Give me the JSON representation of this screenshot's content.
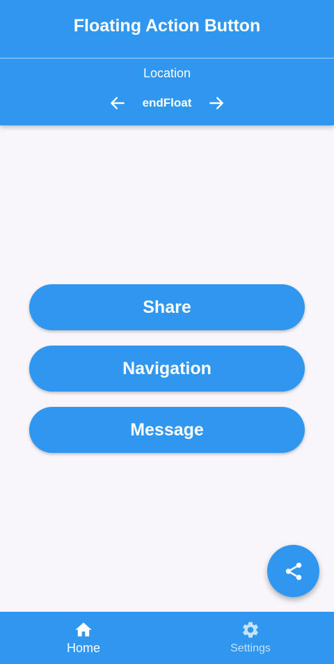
{
  "appbar": {
    "title": "Floating Action Button",
    "location_label": "Location",
    "location_value": "endFloat",
    "prev_icon": "arrow-left-icon",
    "next_icon": "arrow-right-icon"
  },
  "buttons": [
    {
      "label": "Share"
    },
    {
      "label": "Navigation"
    },
    {
      "label": "Message"
    }
  ],
  "fab": {
    "icon": "share-icon"
  },
  "bottom_nav": {
    "items": [
      {
        "label": "Home",
        "icon": "home-icon",
        "active": true
      },
      {
        "label": "Settings",
        "icon": "gear-icon",
        "active": false
      }
    ]
  },
  "colors": {
    "primary": "#2f97ef",
    "background": "#f8f6fa",
    "on_primary": "#ffffff"
  }
}
